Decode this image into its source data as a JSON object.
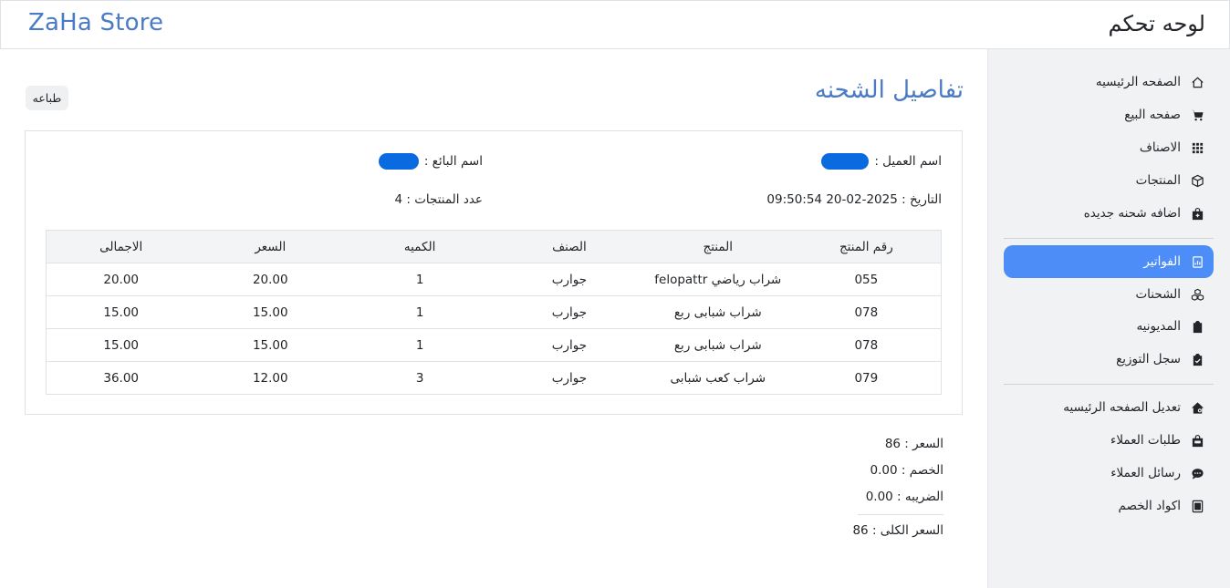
{
  "header": {
    "brand": "ZaHa Store",
    "dashboard_title": "لوحه تحكم"
  },
  "sidebar": {
    "group1": [
      {
        "label": "الصفحه الرئيسيه",
        "icon": "home-icon"
      },
      {
        "label": "صفحه البيع",
        "icon": "cart-icon"
      },
      {
        "label": "الاصناف",
        "icon": "grid-icon"
      },
      {
        "label": "المنتجات",
        "icon": "box-icon"
      },
      {
        "label": "اضافه شحنه جديده",
        "icon": "bag-icon"
      }
    ],
    "group2": [
      {
        "label": "الفواتير",
        "icon": "receipt-icon",
        "active": true
      },
      {
        "label": "الشحنات",
        "icon": "boxes-icon"
      },
      {
        "label": "المديونيه",
        "icon": "clipboard-icon"
      },
      {
        "label": "سجل التوزيع",
        "icon": "clipboard-check-icon"
      }
    ],
    "group3": [
      {
        "label": "تعديل الصفحه الرئيسيه",
        "icon": "house-gear-icon"
      },
      {
        "label": "طلبات العملاء",
        "icon": "basket-icon"
      },
      {
        "label": "رسائل العملاء",
        "icon": "chat-icon"
      },
      {
        "label": "اكواد الخصم",
        "icon": "voucher-icon"
      }
    ],
    "active_color": "#4c8df7"
  },
  "main": {
    "title": "تفاصيل الشحنه",
    "print_label": "طباعه",
    "customer_label": "اسم العميل :",
    "seller_label": "اسم البائع :",
    "date_text": "التاريخ : 2025-02-20 09:50:54",
    "count_text": "عدد المنتجات : 4",
    "table": {
      "headers": [
        "رقم المنتج",
        "المنتج",
        "الصنف",
        "الكميه",
        "السعر",
        "الاجمالى"
      ],
      "rows": [
        [
          "055",
          "شراب رياضي felopattr",
          "جوارب",
          "1",
          "20.00",
          "20.00"
        ],
        [
          "078",
          "شراب شبابى ربع",
          "جوارب",
          "1",
          "15.00",
          "15.00"
        ],
        [
          "078",
          "شراب شبابى ربع",
          "جوارب",
          "1",
          "15.00",
          "15.00"
        ],
        [
          "079",
          "شراب كعب شبابى",
          "جوارب",
          "3",
          "12.00",
          "36.00"
        ]
      ]
    },
    "summary": {
      "price": "السعر : 86",
      "discount": "الخصم : 0.00",
      "tax": "الضريبه : 0.00",
      "total": "السعر الكلى : 86"
    },
    "accent_color": "#4a7bc4",
    "redaction_color": "#0a6be0"
  }
}
